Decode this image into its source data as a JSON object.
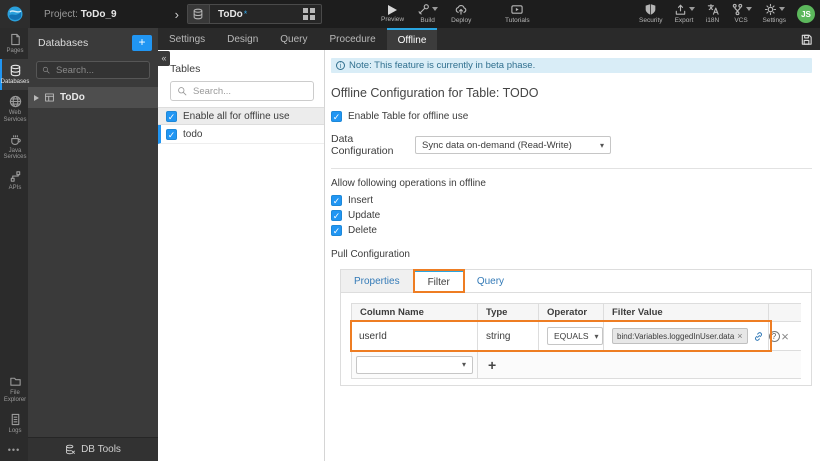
{
  "colors": {
    "accent_blue": "#2196f3",
    "annotation_orange": "#ee7d23",
    "note_bg": "#d9edf7",
    "avatar_green": "#5cb85c",
    "active_tab_blue": "#2aa5e0"
  },
  "topbar": {
    "project_prefix": "Project:",
    "project_name": "ToDo_9",
    "chevron": "›",
    "artifact_tab": {
      "label": "ToDo",
      "modified_marker": "*"
    },
    "preview": "Preview",
    "build": "Build",
    "deploy": "Deploy",
    "tutorials": "Tutorials",
    "security": "Security",
    "export": "Export",
    "i18n": "i18N",
    "vcs": "VCS",
    "settings": "Settings",
    "avatar_initials": "JS"
  },
  "rail": {
    "pages": "Pages",
    "databases": "Databases",
    "web_services": "Web Services",
    "java_services": "Java Services",
    "apis": "APIs",
    "file_explorer": "File Explorer",
    "logs": "Logs",
    "more": "•••"
  },
  "db_panel": {
    "title": "Databases",
    "add_button": "+",
    "collapse_icon": "«",
    "search_placeholder": "Search...",
    "tree": [
      {
        "label": "ToDo"
      }
    ],
    "db_tools_label": "DB Tools"
  },
  "tables_panel": {
    "title": "Tables",
    "search_placeholder": "Search...",
    "enable_all_label": "Enable all for offline use",
    "tables": [
      {
        "label": "todo"
      }
    ]
  },
  "workspace": {
    "tabs": [
      {
        "label": "Settings"
      },
      {
        "label": "Design"
      },
      {
        "label": "Query"
      },
      {
        "label": "Procedure"
      },
      {
        "label": "Offline",
        "active": true
      }
    ],
    "note": "Note: This feature is currently in beta phase.",
    "heading": "Offline Configuration for Table: TODO",
    "enable_table_label": "Enable Table for offline use",
    "data_config_label": "Data Configuration",
    "data_config_value": "Sync data on-demand (Read-Write)",
    "operations_label": "Allow following operations in offline",
    "operations": [
      {
        "label": "Insert"
      },
      {
        "label": "Update"
      },
      {
        "label": "Delete"
      }
    ],
    "pull_config_label": "Pull Configuration",
    "pull_tabs": [
      {
        "label": "Properties"
      },
      {
        "label": "Filter",
        "active": true
      },
      {
        "label": "Query"
      }
    ],
    "filter_grid": {
      "headers": [
        "Column Name",
        "Type",
        "Operator",
        "Filter Value"
      ],
      "rows": [
        {
          "column_name": "userId",
          "type": "string",
          "operator": "EQUALS",
          "filter_value": "bind:Variables.loggedInUser.data"
        }
      ],
      "add_label": "+"
    }
  }
}
